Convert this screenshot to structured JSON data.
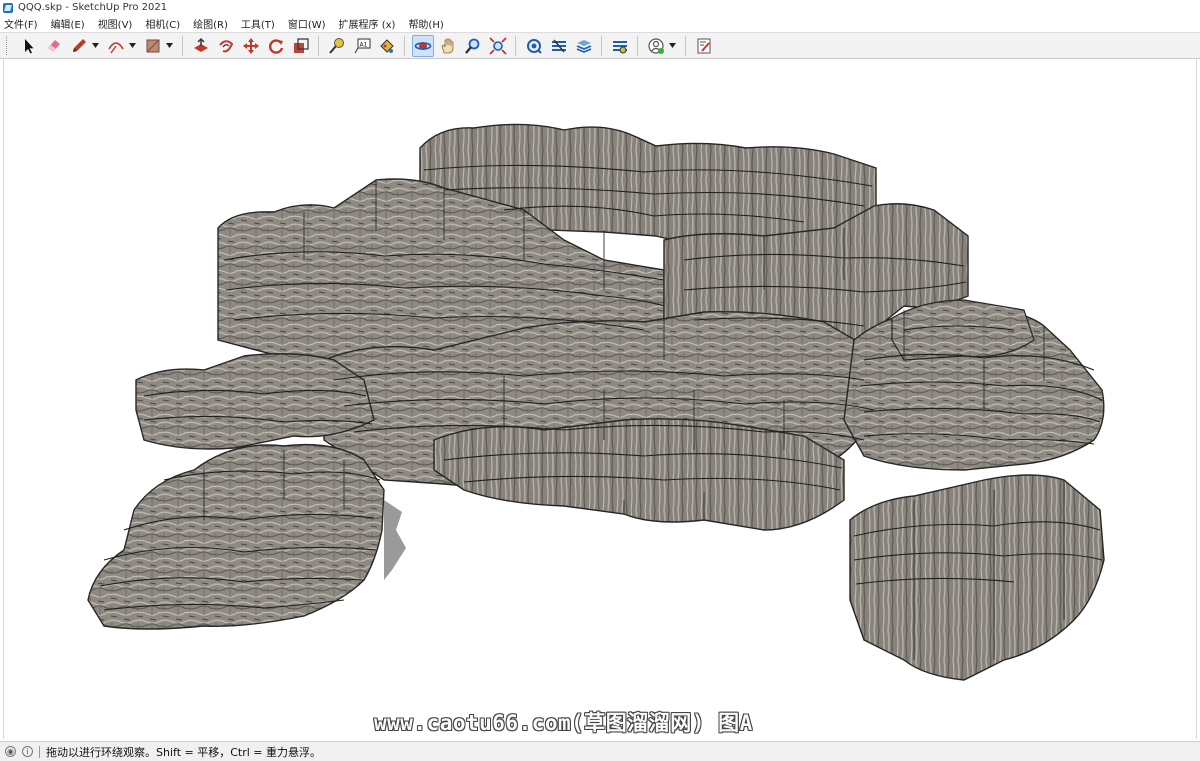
{
  "window": {
    "title": "QQQ.skp - SketchUp Pro 2021"
  },
  "menu": [
    "文件(F)",
    "编辑(E)",
    "视图(V)",
    "相机(C)",
    "绘图(R)",
    "工具(T)",
    "窗口(W)",
    "扩展程序 (x)",
    "帮助(H)"
  ],
  "toolbar": {
    "tools": [
      {
        "icon": "select-arrow-icon"
      },
      {
        "icon": "eraser-icon"
      },
      {
        "icon": "pencil-line-icon",
        "dropdown": true
      },
      {
        "icon": "arc-icon",
        "dropdown": true
      },
      {
        "icon": "rectangle-shape-icon",
        "dropdown": true
      },
      {
        "icon": "push-pull-icon"
      },
      {
        "icon": "offset-icon"
      },
      {
        "icon": "move-icon"
      },
      {
        "icon": "rotate-icon"
      },
      {
        "icon": "scale-icon"
      },
      {
        "icon": "tape-measure-icon"
      },
      {
        "icon": "text-label-icon"
      },
      {
        "icon": "paint-bucket-icon"
      },
      {
        "icon": "orbit-icon",
        "active": true
      },
      {
        "icon": "pan-hand-icon"
      },
      {
        "icon": "zoom-icon"
      },
      {
        "icon": "zoom-extents-icon"
      },
      {
        "icon": "warehouse-icon"
      },
      {
        "icon": "extension-warehouse-icon"
      },
      {
        "icon": "layout-send-icon"
      },
      {
        "icon": "extension-manager-icon"
      },
      {
        "icon": "user-account-icon",
        "dropdown": true
      },
      {
        "icon": "model-info-icon"
      }
    ]
  },
  "viewport": {
    "watermark": "www.caotu66.com(草图溜溜网) 图A"
  },
  "status": {
    "message": "拖动以进行环绕观察。Shift = 平移，Ctrl = 重力悬浮。"
  },
  "colors": {
    "toolbar_bg": "#f3f3f3",
    "active_tool": "#cfe3f7",
    "rock_fill": "#8a857d",
    "rock_edge": "#2a2a2a"
  }
}
